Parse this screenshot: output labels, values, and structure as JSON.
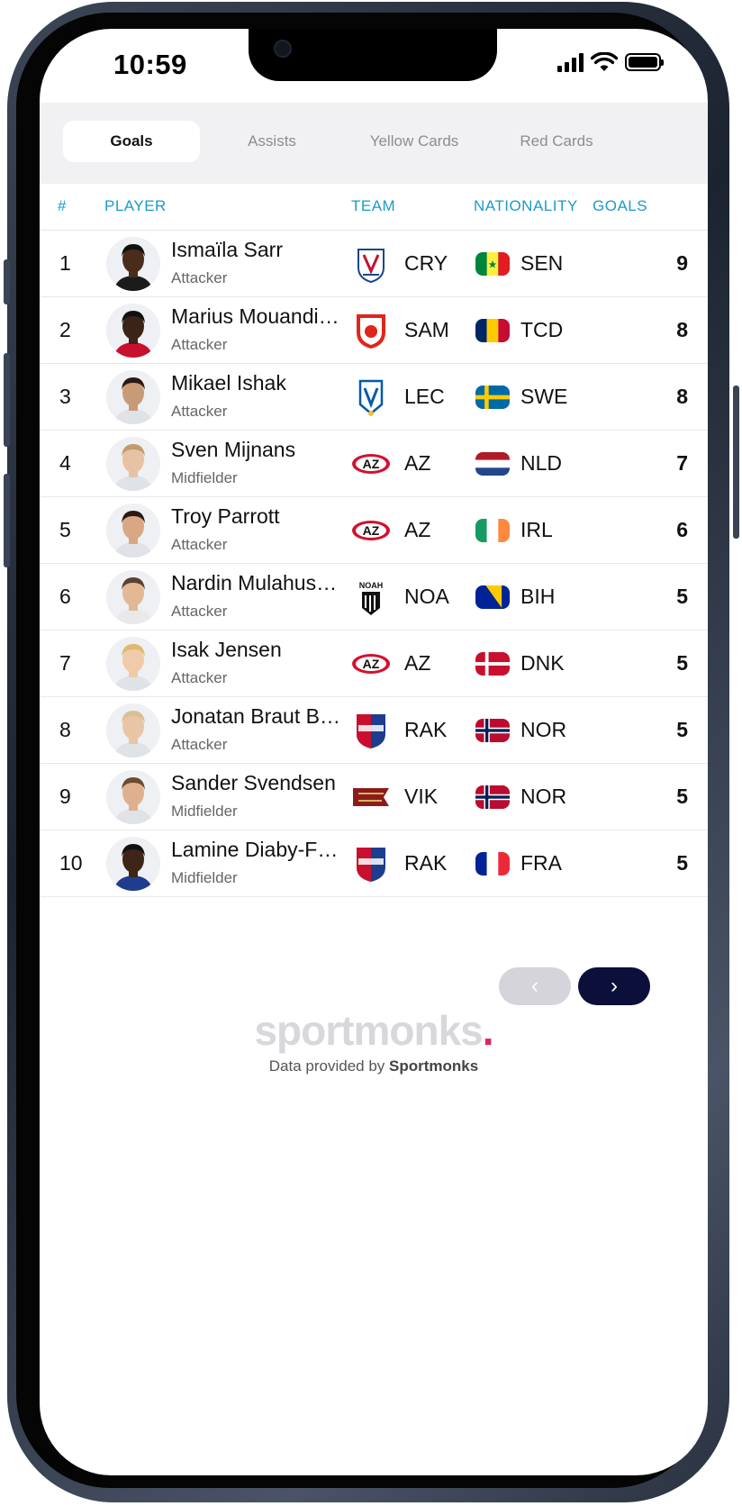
{
  "status_bar": {
    "time": "10:59"
  },
  "tabs": [
    {
      "label": "Goals",
      "active": true
    },
    {
      "label": "Assists",
      "active": false
    },
    {
      "label": "Yellow Cards",
      "active": false
    },
    {
      "label": "Red Cards",
      "active": false
    }
  ],
  "table": {
    "headers": {
      "rank": "#",
      "player": "PLAYER",
      "team": "TEAM",
      "nationality": "NATIONALITY",
      "goals": "GOALS"
    },
    "rows": [
      {
        "rank": "1",
        "name": "Ismaïla Sarr",
        "position": "Attacker",
        "team": "CRY",
        "nationality": "SEN",
        "goals": "9",
        "flag": "senegal",
        "crest": "crystal-palace-crest-icon"
      },
      {
        "rank": "2",
        "name": "Marius Mouandi…",
        "position": "Attacker",
        "team": "SAM",
        "nationality": "TCD",
        "goals": "8",
        "flag": "chad",
        "crest": "samsunspor-crest-icon"
      },
      {
        "rank": "3",
        "name": "Mikael Ishak",
        "position": "Attacker",
        "team": "LEC",
        "nationality": "SWE",
        "goals": "8",
        "flag": "sweden",
        "crest": "lech-poznan-crest-icon"
      },
      {
        "rank": "4",
        "name": "Sven Mijnans",
        "position": "Midfielder",
        "team": "AZ",
        "nationality": "NLD",
        "goals": "7",
        "flag": "netherlands",
        "crest": "az-crest-icon"
      },
      {
        "rank": "5",
        "name": "Troy Parrott",
        "position": "Attacker",
        "team": "AZ",
        "nationality": "IRL",
        "goals": "6",
        "flag": "ireland",
        "crest": "az-crest-icon"
      },
      {
        "rank": "6",
        "name": "Nardin Mulahus…",
        "position": "Attacker",
        "team": "NOA",
        "nationality": "BIH",
        "goals": "5",
        "flag": "bosnia",
        "crest": "noah-crest-icon"
      },
      {
        "rank": "7",
        "name": "Isak Jensen",
        "position": "Attacker",
        "team": "AZ",
        "nationality": "DNK",
        "goals": "5",
        "flag": "denmark",
        "crest": "az-crest-icon"
      },
      {
        "rank": "8",
        "name": "Jonatan Braut B…",
        "position": "Attacker",
        "team": "RAK",
        "nationality": "NOR",
        "goals": "5",
        "flag": "norway",
        "crest": "rakow-crest-icon"
      },
      {
        "rank": "9",
        "name": "Sander Svendsen",
        "position": "Midfielder",
        "team": "VIK",
        "nationality": "NOR",
        "goals": "5",
        "flag": "norway",
        "crest": "viking-crest-icon"
      },
      {
        "rank": "10",
        "name": "Lamine Diaby-F…",
        "position": "Midfielder",
        "team": "RAK",
        "nationality": "FRA",
        "goals": "5",
        "flag": "france",
        "crest": "rakow-crest-icon"
      }
    ]
  },
  "pagination": {
    "prev": "‹",
    "next": "›"
  },
  "footer": {
    "logo": "sportmonks",
    "logo_dot": ".",
    "credit_prefix": "Data provided by ",
    "credit_brand": "Sportmonks"
  },
  "colors": {
    "accent": "#1c9bc8",
    "next_button": "#0b0f3a",
    "prev_button": "#d4d4da",
    "logo_dot": "#e0245e"
  }
}
